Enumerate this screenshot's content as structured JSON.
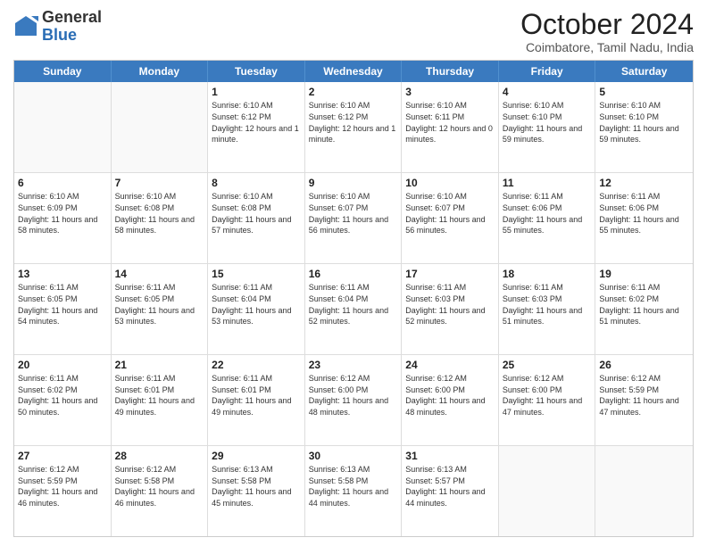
{
  "logo": {
    "general": "General",
    "blue": "Blue"
  },
  "header": {
    "month": "October 2024",
    "location": "Coimbatore, Tamil Nadu, India"
  },
  "days": [
    "Sunday",
    "Monday",
    "Tuesday",
    "Wednesday",
    "Thursday",
    "Friday",
    "Saturday"
  ],
  "weeks": [
    [
      {
        "day": "",
        "sunrise": "",
        "sunset": "",
        "daylight": ""
      },
      {
        "day": "",
        "sunrise": "",
        "sunset": "",
        "daylight": ""
      },
      {
        "day": "1",
        "sunrise": "Sunrise: 6:10 AM",
        "sunset": "Sunset: 6:12 PM",
        "daylight": "Daylight: 12 hours and 1 minute."
      },
      {
        "day": "2",
        "sunrise": "Sunrise: 6:10 AM",
        "sunset": "Sunset: 6:12 PM",
        "daylight": "Daylight: 12 hours and 1 minute."
      },
      {
        "day": "3",
        "sunrise": "Sunrise: 6:10 AM",
        "sunset": "Sunset: 6:11 PM",
        "daylight": "Daylight: 12 hours and 0 minutes."
      },
      {
        "day": "4",
        "sunrise": "Sunrise: 6:10 AM",
        "sunset": "Sunset: 6:10 PM",
        "daylight": "Daylight: 11 hours and 59 minutes."
      },
      {
        "day": "5",
        "sunrise": "Sunrise: 6:10 AM",
        "sunset": "Sunset: 6:10 PM",
        "daylight": "Daylight: 11 hours and 59 minutes."
      }
    ],
    [
      {
        "day": "6",
        "sunrise": "Sunrise: 6:10 AM",
        "sunset": "Sunset: 6:09 PM",
        "daylight": "Daylight: 11 hours and 58 minutes."
      },
      {
        "day": "7",
        "sunrise": "Sunrise: 6:10 AM",
        "sunset": "Sunset: 6:08 PM",
        "daylight": "Daylight: 11 hours and 58 minutes."
      },
      {
        "day": "8",
        "sunrise": "Sunrise: 6:10 AM",
        "sunset": "Sunset: 6:08 PM",
        "daylight": "Daylight: 11 hours and 57 minutes."
      },
      {
        "day": "9",
        "sunrise": "Sunrise: 6:10 AM",
        "sunset": "Sunset: 6:07 PM",
        "daylight": "Daylight: 11 hours and 56 minutes."
      },
      {
        "day": "10",
        "sunrise": "Sunrise: 6:10 AM",
        "sunset": "Sunset: 6:07 PM",
        "daylight": "Daylight: 11 hours and 56 minutes."
      },
      {
        "day": "11",
        "sunrise": "Sunrise: 6:11 AM",
        "sunset": "Sunset: 6:06 PM",
        "daylight": "Daylight: 11 hours and 55 minutes."
      },
      {
        "day": "12",
        "sunrise": "Sunrise: 6:11 AM",
        "sunset": "Sunset: 6:06 PM",
        "daylight": "Daylight: 11 hours and 55 minutes."
      }
    ],
    [
      {
        "day": "13",
        "sunrise": "Sunrise: 6:11 AM",
        "sunset": "Sunset: 6:05 PM",
        "daylight": "Daylight: 11 hours and 54 minutes."
      },
      {
        "day": "14",
        "sunrise": "Sunrise: 6:11 AM",
        "sunset": "Sunset: 6:05 PM",
        "daylight": "Daylight: 11 hours and 53 minutes."
      },
      {
        "day": "15",
        "sunrise": "Sunrise: 6:11 AM",
        "sunset": "Sunset: 6:04 PM",
        "daylight": "Daylight: 11 hours and 53 minutes."
      },
      {
        "day": "16",
        "sunrise": "Sunrise: 6:11 AM",
        "sunset": "Sunset: 6:04 PM",
        "daylight": "Daylight: 11 hours and 52 minutes."
      },
      {
        "day": "17",
        "sunrise": "Sunrise: 6:11 AM",
        "sunset": "Sunset: 6:03 PM",
        "daylight": "Daylight: 11 hours and 52 minutes."
      },
      {
        "day": "18",
        "sunrise": "Sunrise: 6:11 AM",
        "sunset": "Sunset: 6:03 PM",
        "daylight": "Daylight: 11 hours and 51 minutes."
      },
      {
        "day": "19",
        "sunrise": "Sunrise: 6:11 AM",
        "sunset": "Sunset: 6:02 PM",
        "daylight": "Daylight: 11 hours and 51 minutes."
      }
    ],
    [
      {
        "day": "20",
        "sunrise": "Sunrise: 6:11 AM",
        "sunset": "Sunset: 6:02 PM",
        "daylight": "Daylight: 11 hours and 50 minutes."
      },
      {
        "day": "21",
        "sunrise": "Sunrise: 6:11 AM",
        "sunset": "Sunset: 6:01 PM",
        "daylight": "Daylight: 11 hours and 49 minutes."
      },
      {
        "day": "22",
        "sunrise": "Sunrise: 6:11 AM",
        "sunset": "Sunset: 6:01 PM",
        "daylight": "Daylight: 11 hours and 49 minutes."
      },
      {
        "day": "23",
        "sunrise": "Sunrise: 6:12 AM",
        "sunset": "Sunset: 6:00 PM",
        "daylight": "Daylight: 11 hours and 48 minutes."
      },
      {
        "day": "24",
        "sunrise": "Sunrise: 6:12 AM",
        "sunset": "Sunset: 6:00 PM",
        "daylight": "Daylight: 11 hours and 48 minutes."
      },
      {
        "day": "25",
        "sunrise": "Sunrise: 6:12 AM",
        "sunset": "Sunset: 6:00 PM",
        "daylight": "Daylight: 11 hours and 47 minutes."
      },
      {
        "day": "26",
        "sunrise": "Sunrise: 6:12 AM",
        "sunset": "Sunset: 5:59 PM",
        "daylight": "Daylight: 11 hours and 47 minutes."
      }
    ],
    [
      {
        "day": "27",
        "sunrise": "Sunrise: 6:12 AM",
        "sunset": "Sunset: 5:59 PM",
        "daylight": "Daylight: 11 hours and 46 minutes."
      },
      {
        "day": "28",
        "sunrise": "Sunrise: 6:12 AM",
        "sunset": "Sunset: 5:58 PM",
        "daylight": "Daylight: 11 hours and 46 minutes."
      },
      {
        "day": "29",
        "sunrise": "Sunrise: 6:13 AM",
        "sunset": "Sunset: 5:58 PM",
        "daylight": "Daylight: 11 hours and 45 minutes."
      },
      {
        "day": "30",
        "sunrise": "Sunrise: 6:13 AM",
        "sunset": "Sunset: 5:58 PM",
        "daylight": "Daylight: 11 hours and 44 minutes."
      },
      {
        "day": "31",
        "sunrise": "Sunrise: 6:13 AM",
        "sunset": "Sunset: 5:57 PM",
        "daylight": "Daylight: 11 hours and 44 minutes."
      },
      {
        "day": "",
        "sunrise": "",
        "sunset": "",
        "daylight": ""
      },
      {
        "day": "",
        "sunrise": "",
        "sunset": "",
        "daylight": ""
      }
    ]
  ]
}
